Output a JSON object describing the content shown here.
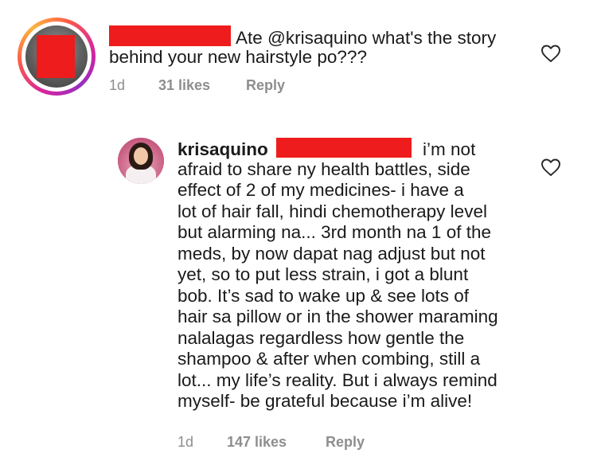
{
  "comments": [
    {
      "lines": [
        {
          "pre": "",
          "after": "Ate @krisaquino what's the story"
        },
        {
          "text": "behind your new hairstyle po???"
        }
      ],
      "time": "1d",
      "likes": "31 likes",
      "reply": "Reply"
    },
    {
      "username": "krisaquino",
      "first_after": "i’m not",
      "lines": [
        "afraid to share ny health battles, side",
        "effect of 2 of my medicines- i have a",
        "lot of hair fall, hindi chemotherapy level",
        "but alarming na... 3rd month na 1 of the",
        "meds, by now dapat nag adjust but not",
        "yet, so to put less strain, i got a blunt",
        "bob. It’s sad to wake up & see lots of",
        "hair sa pillow or in the shower maraming",
        "nalalagas regardless how gentle the",
        "shampoo & after when combing, still a",
        "lot... my life’s reality. But i always remind",
        "myself- be grateful because i’m alive!"
      ],
      "time": "1d",
      "likes": "147 likes",
      "reply": "Reply"
    }
  ],
  "icons": {
    "like": "heart-outline-icon"
  }
}
